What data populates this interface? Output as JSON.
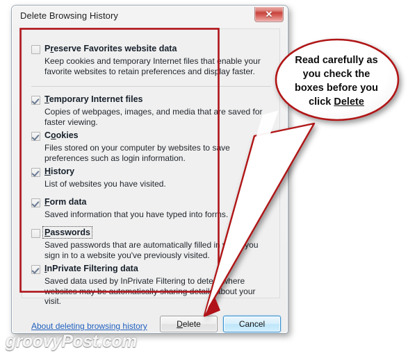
{
  "window": {
    "title": "Delete Browsing History",
    "close_button_glyph": "✕",
    "close_icon_name": "close-icon"
  },
  "options": [
    {
      "id": "preserve-favorites",
      "checked": false,
      "focused": false,
      "accel": "r",
      "label_before": "P",
      "label_after": "eserve Favorites website data",
      "label_full": "Preserve Favorites website data",
      "description": "Keep cookies and temporary Internet files that enable your favorite websites to retain preferences and display faster."
    },
    {
      "id": "temporary-internet-files",
      "checked": true,
      "focused": false,
      "accel": "T",
      "label_before": "",
      "label_after": "emporary Internet files",
      "label_full": "Temporary Internet files",
      "description": "Copies of webpages, images, and media that are saved for faster viewing."
    },
    {
      "id": "cookies",
      "checked": true,
      "focused": false,
      "accel": "o",
      "label_before": "C",
      "label_after": "okies",
      "label_full": "Cookies",
      "description": "Files stored on your computer by websites to save preferences such as login information."
    },
    {
      "id": "history",
      "checked": true,
      "focused": false,
      "accel": "H",
      "label_before": "",
      "label_after": "istory",
      "label_full": "History",
      "description": "List of websites you have visited."
    },
    {
      "id": "form-data",
      "checked": true,
      "focused": false,
      "accel": "F",
      "label_before": "",
      "label_after": "orm data",
      "label_full": "Form data",
      "description": "Saved information that you have typed into forms."
    },
    {
      "id": "passwords",
      "checked": false,
      "focused": true,
      "accel": "P",
      "label_before": "",
      "label_after": "asswords",
      "label_full": "Passwords",
      "description": "Saved passwords that are automatically filled in when you sign in to a website you've previously visited."
    },
    {
      "id": "inprivate-filtering-data",
      "checked": true,
      "focused": false,
      "accel": "I",
      "label_before": "",
      "label_after": "nPrivate Filtering data",
      "label_full": "InPrivate Filtering data",
      "description": "Saved data used by InPrivate Filtering to detect where websites may be automatically sharing details about your visit."
    }
  ],
  "footer": {
    "help_link": "About deleting browsing history",
    "delete_button": {
      "accel": "D",
      "rest": "elete",
      "full": "Delete"
    },
    "cancel_button": {
      "full": "Cancel"
    }
  },
  "annotation": {
    "callout_line1": "Read carefully as",
    "callout_line2": "you check the",
    "callout_line3": "boxes before you",
    "callout_line4_prefix": "click ",
    "callout_line4_underlined": "Delete",
    "accent_color": "#b01319",
    "highlight_box_color": "#b01319"
  },
  "watermark": "groovyPost.com"
}
